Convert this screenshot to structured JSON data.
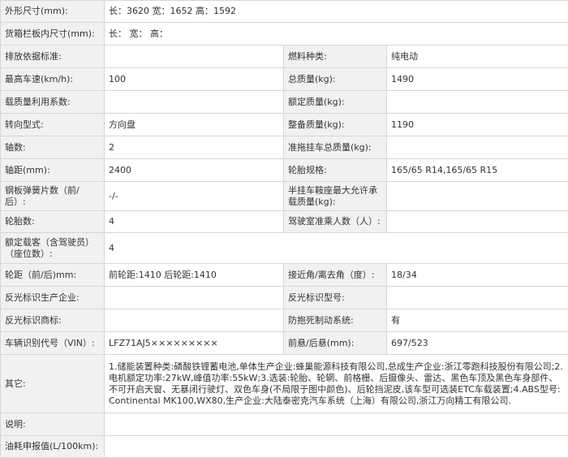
{
  "rows": [
    {
      "label": "外形尺寸(mm):",
      "value": "长：3620 宽：1652 高：1592"
    },
    {
      "label": "货箱栏板内尺寸(mm):",
      "value": "长：  宽：  高："
    },
    {
      "label": "排放依据标准:",
      "value": "",
      "label2": "燃料种类:",
      "value2": "纯电动"
    },
    {
      "label": "最高车速(km/h):",
      "value": "100",
      "label2": "总质量(kg):",
      "value2": "1490"
    },
    {
      "label": "载质量利用系数:",
      "value": "",
      "label2": "额定质量(kg):",
      "value2": ""
    },
    {
      "label": "转向型式:",
      "value": "方向盘",
      "label2": "整备质量(kg):",
      "value2": "1190"
    },
    {
      "label": "轴数:",
      "value": "2",
      "label2": "准拖挂车总质量(kg):",
      "value2": ""
    },
    {
      "label": "轴距(mm):",
      "value": "2400",
      "label2": "轮胎规格:",
      "value2": "165/65 R14,165/65 R15"
    },
    {
      "label": "钢板弹簧片数（前/后）:",
      "value": "-/-",
      "label2": "半挂车鞍座最大允许承载质量(kg):",
      "value2": ""
    },
    {
      "label": "轮胎数:",
      "value": "4",
      "label2": "驾驶室准乘人数（人）:",
      "value2": ""
    },
    {
      "label": "额定载客（含驾驶员）（座位数）:",
      "value": "4"
    },
    {
      "label": "轮距（前/后)mm:",
      "value": "前轮距:1410 后轮距:1410",
      "label2": "接近角/离去角（度）:",
      "value2": "18/34"
    },
    {
      "label": "反光标识生产企业:",
      "value": "",
      "label2": "反光标识型号:",
      "value2": ""
    },
    {
      "label": "反光标识商标:",
      "value": "",
      "label2": "防抱死制动系统:",
      "value2": "有"
    },
    {
      "label": "车辆识别代号（VIN）:",
      "value": "LFZ71AJ5×××××××××",
      "label2": "前悬/后悬(mm):",
      "value2": "697/523"
    },
    {
      "label": "其它:",
      "value": "1.储能装置种类:磷酸铁锂蓄电池,单体生产企业:蜂巢能源科技有限公司,总成生产企业:浙江零跑科技股份有限公司;2.电机额定功率:27kW,峰值功率:55kW;3.选装:轮胎、轮辋、前格栅、后摄像头、雷达、黑色车顶及黑色车身部件、不可开启天窗、无暴闭行驶灯、双色车身(不局限于图中颜色)、后轮挡泥皮,该车型可选装ETC车载装置;4.ABS型号:Continental MK100,WX80,生产企业:大陆泰密克汽车系统（上海）有限公司,浙江万向精工有限公司."
    },
    {
      "label": "说明:",
      "value": ""
    },
    {
      "label": "油耗申报值(L/100km):",
      "value": ""
    }
  ]
}
